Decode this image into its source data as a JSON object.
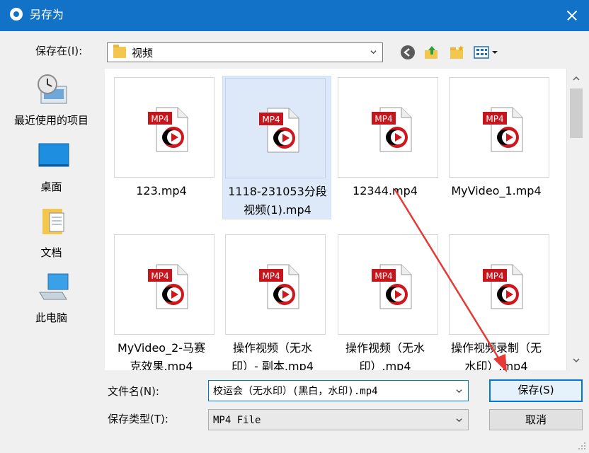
{
  "window": {
    "title": "另存为"
  },
  "location": {
    "label": "保存在(I):",
    "current_folder": "视频"
  },
  "places": [
    {
      "label": "最近使用的项目",
      "icon": "recent-items-icon"
    },
    {
      "label": "桌面",
      "icon": "desktop-icon"
    },
    {
      "label": "文档",
      "icon": "documents-icon"
    },
    {
      "label": "此电脑",
      "icon": "computer-icon"
    }
  ],
  "files": [
    {
      "name": "123.mp4",
      "badge": "MP4"
    },
    {
      "name": "1118-231053分段视频(1).mp4",
      "name_lines": [
        "1118-231053分段",
        "视频(1).mp4"
      ],
      "badge": "MP4",
      "selected": true
    },
    {
      "name": "12344.mp4",
      "badge": "MP4"
    },
    {
      "name": "MyVideo_1.mp4",
      "badge": "MP4"
    },
    {
      "name_lines": [
        "MyVideo_2-马赛",
        "克效果.mp4"
      ],
      "badge": "MP4"
    },
    {
      "name_lines": [
        "操作视频（无水",
        "印）- 副本.mp4"
      ],
      "badge": "MP4"
    },
    {
      "name_lines": [
        "操作视频（无水",
        "印）.mp4"
      ],
      "badge": "MP4"
    },
    {
      "name_lines": [
        "操作视频录制（无",
        "水印）.mp4"
      ],
      "badge": "MP4"
    }
  ],
  "filename": {
    "label": "文件名(N):",
    "value": "校运会（无水印）(黑白，水印).mp4"
  },
  "filetype": {
    "label": "保存类型(T):",
    "value": "MP4 File"
  },
  "buttons": {
    "save": "保存(S)",
    "cancel": "取消"
  },
  "colors": {
    "titlebar": "#1272c7",
    "accent": "#0078d7",
    "selection": "#dde9f8",
    "annotation_arrow": "#e53935",
    "mp4_badge": "#c4161c"
  }
}
